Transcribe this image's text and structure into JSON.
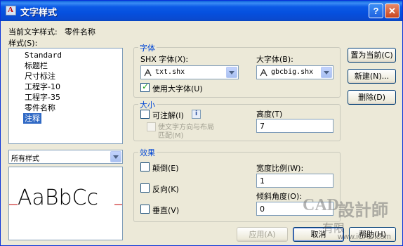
{
  "window": {
    "title": "文字样式",
    "help_label": "?",
    "close_label": "✕"
  },
  "current_style": {
    "label": "当前文字样式:",
    "value": "零件名称"
  },
  "styles_label": "样式(S):",
  "style_list": [
    "Standard",
    "标题栏",
    "尺寸标注",
    "工程字-10",
    "工程字-35",
    "零件名称",
    "注释"
  ],
  "selected_style": "注释",
  "filter": {
    "value": "所有样式"
  },
  "preview_text": "AaBbCc",
  "font_group": {
    "title": "字体",
    "shx_label": "SHX 字体(X):",
    "shx_value": "txt.shx",
    "bigfont_label": "大字体(B):",
    "bigfont_value": "gbcbig.shx",
    "use_bigfont_label": "使用大字体(U)",
    "use_bigfont_checked": true
  },
  "size_group": {
    "title": "大小",
    "annotative_label": "可注解(I)",
    "annotative_checked": false,
    "info_icon": "i",
    "match_orientation_line1": "使文字方向与布局",
    "match_orientation_line2": "匹配(M)",
    "height_label": "高度(T)",
    "height_value": "7"
  },
  "effects_group": {
    "title": "效果",
    "upside_down_label": "颠倒(E)",
    "backwards_label": "反向(K)",
    "vertical_label": "垂直(V)",
    "width_factor_label": "宽度比例(W):",
    "width_factor_value": "1",
    "oblique_label": "倾斜角度(O):",
    "oblique_value": "0"
  },
  "buttons": {
    "set_current": "置为当前(C)",
    "new": "新建(N)...",
    "delete": "删除(D)",
    "apply": "应用(A)",
    "cancel": "取消",
    "help": "帮助(H)"
  },
  "watermark": {
    "text1": "CAD",
    "text2": "設計師",
    "text3": "有限",
    "text4": "www.iCAD.com"
  },
  "colors": {
    "titlebar": "#0550de",
    "selection": "#316ac5",
    "group_title": "#0046d5",
    "preview_baseline": "#c00000"
  }
}
